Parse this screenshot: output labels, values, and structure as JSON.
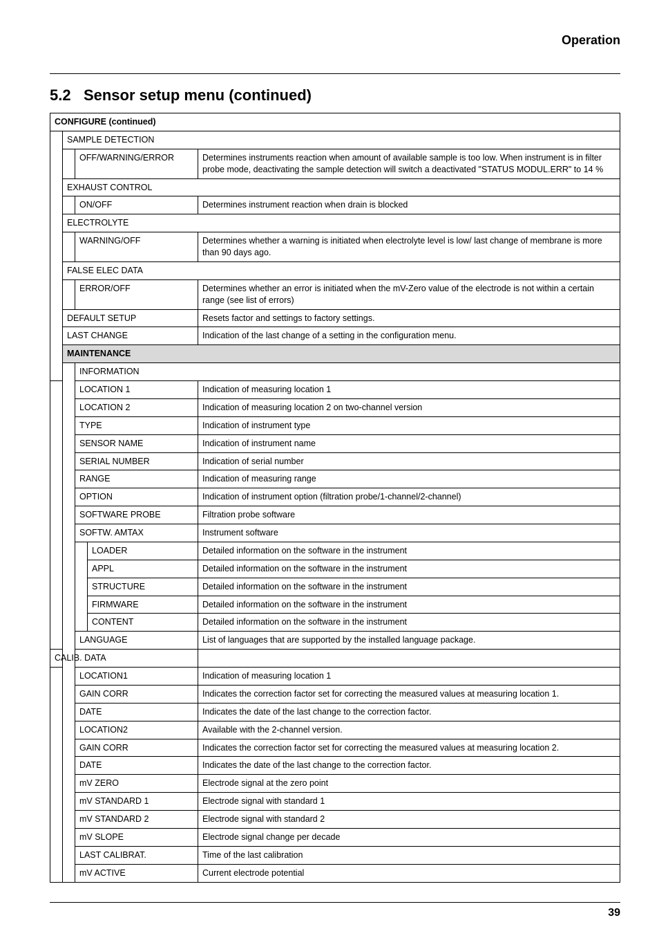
{
  "header": {
    "category": "Operation",
    "section_number": "5.2",
    "section_title": "Sensor setup menu (continued)"
  },
  "table": {
    "group_configure": "CONFIGURE (continued)",
    "sample_detection": "SAMPLE DETECTION",
    "sd_opt": "OFF/WARNING/ERROR",
    "sd_desc": "Determines instruments reaction when amount of available sample is too low. When instrument is in filter probe mode, deactivating the sample detection will switch a deactivated \"STATUS MODUL.ERR\" to 14 %",
    "exhaust_control": "EXHAUST CONTROL",
    "ec_opt": "ON/OFF",
    "ec_desc": "Determines instrument reaction when drain is blocked",
    "electrolyte": "ELECTROLYTE",
    "el_opt": "WARNING/OFF",
    "el_desc": "Determines whether a warning is initiated when electrolyte level is low/ last change of membrane is more than 90 days ago.",
    "false_elec": "FALSE ELEC DATA",
    "fe_opt": "ERROR/OFF",
    "fe_desc": "Determines whether an error is initiated when the mV-Zero value of the electrode is not within a certain range (see list of errors)",
    "default_setup": "DEFAULT SETUP",
    "default_setup_desc": "Resets factor and settings to factory settings.",
    "last_change": "LAST CHANGE",
    "last_change_desc": "Indication of the last change of a setting in the configuration menu.",
    "group_maintenance": "MAINTENANCE",
    "information": "INFORMATION",
    "loc1": "LOCATION 1",
    "loc1_desc": "Indication of measuring location 1",
    "loc2": "LOCATION 2",
    "loc2_desc": "Indication of measuring location 2 on two-channel version",
    "type": "TYPE",
    "type_desc": "Indication of instrument type",
    "sensor_name": "SENSOR NAME",
    "sensor_name_desc": "Indication of instrument name",
    "serial": "SERIAL NUMBER",
    "serial_desc": "Indication of serial number",
    "range": "RANGE",
    "range_desc": "Indication of measuring range",
    "option": "OPTION",
    "option_desc": "Indication of instrument option (filtration probe/1-channel/2-channel)",
    "sw_probe": "SOFTWARE PROBE",
    "sw_probe_desc": "Filtration probe software",
    "sw_amtax": "SOFTW. AMTAX",
    "sw_amtax_desc": "Instrument software",
    "loader": "LOADER",
    "loader_desc": "Detailed information on the software in the instrument",
    "appl": "APPL",
    "appl_desc": "Detailed information on the software in the instrument",
    "structure": "STRUCTURE",
    "structure_desc": "Detailed information on the software in the instrument",
    "firmware": "FIRMWARE",
    "firmware_desc": "Detailed information on the software in the instrument",
    "content": "CONTENT",
    "content_desc": "Detailed information on the software in the instrument",
    "language": "LANGUAGE",
    "language_desc": "List of languages that are supported by the installed language package.",
    "calib_data": "CALIB. DATA",
    "cd_loc1": "LOCATION1",
    "cd_loc1_desc": "Indication of measuring location 1",
    "gain1": "GAIN CORR",
    "gain1_desc": "Indicates the correction factor set for correcting the measured values at measuring location 1.",
    "date1": "DATE",
    "date1_desc": "Indicates the date of the last change to the correction factor.",
    "cd_loc2": "LOCATION2",
    "cd_loc2_desc": "Available with the 2-channel version.",
    "gain2": "GAIN CORR",
    "gain2_desc": "Indicates the correction factor set for correcting the measured values at measuring location 2.",
    "date2": "DATE",
    "date2_desc": "Indicates the date of the last change to the correction factor.",
    "mvzero": "mV ZERO",
    "mvzero_desc": "Electrode signal at the zero point",
    "mvstd1": "mV STANDARD 1",
    "mvstd1_desc": "Electrode signal with standard 1",
    "mvstd2": "mV STANDARD 2",
    "mvstd2_desc": "Electrode signal with standard 2",
    "mvslope": "mV SLOPE",
    "mvslope_desc": "Electrode signal change per decade",
    "lastcal": "LAST CALIBRAT.",
    "lastcal_desc": "Time of the last calibration",
    "mvactive": "mV ACTIVE",
    "mvactive_desc": "Current electrode potential"
  },
  "footer": {
    "page": "39"
  }
}
